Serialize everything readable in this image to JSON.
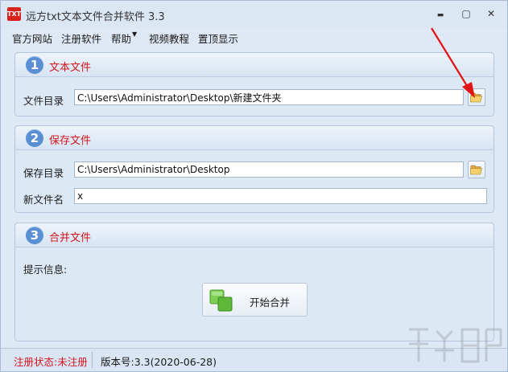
{
  "window": {
    "title": "远方txt文本文件合并软件 3.3",
    "app_icon_text": "TXT",
    "minimize_glyph": "▬",
    "restore_glyph": "▢",
    "close_glyph": "✕"
  },
  "menu": {
    "items": [
      {
        "label": "官方网站"
      },
      {
        "label": "注册软件"
      },
      {
        "label": "帮助"
      },
      {
        "label": "视频教程"
      },
      {
        "label": "置顶显示"
      }
    ]
  },
  "panel1": {
    "number": "1",
    "title": "文本文件",
    "dir_label": "文件目录",
    "dir_value": "C:\\Users\\Administrator\\Desktop\\新建文件夹"
  },
  "panel2": {
    "number": "2",
    "title": "保存文件",
    "save_dir_label": "保存目录",
    "save_dir_value": "C:\\Users\\Administrator\\Desktop",
    "new_name_label": "新文件名",
    "new_name_value": "x"
  },
  "panel3": {
    "number": "3",
    "title": "合并文件",
    "hint_label": "提示信息:",
    "start_label": "开始合并"
  },
  "status": {
    "registration": "注册状态:未注册",
    "version": "版本号:3.3(2020-06-28)"
  },
  "icons": {
    "folder": "folder-open-icon",
    "merge": "merge-squares-icon",
    "arrow": "red-arrow-annotation"
  },
  "colors": {
    "accent_red": "#d4141b",
    "step_blue": "#5b8fd3",
    "merge_green": "#6cc04a"
  }
}
